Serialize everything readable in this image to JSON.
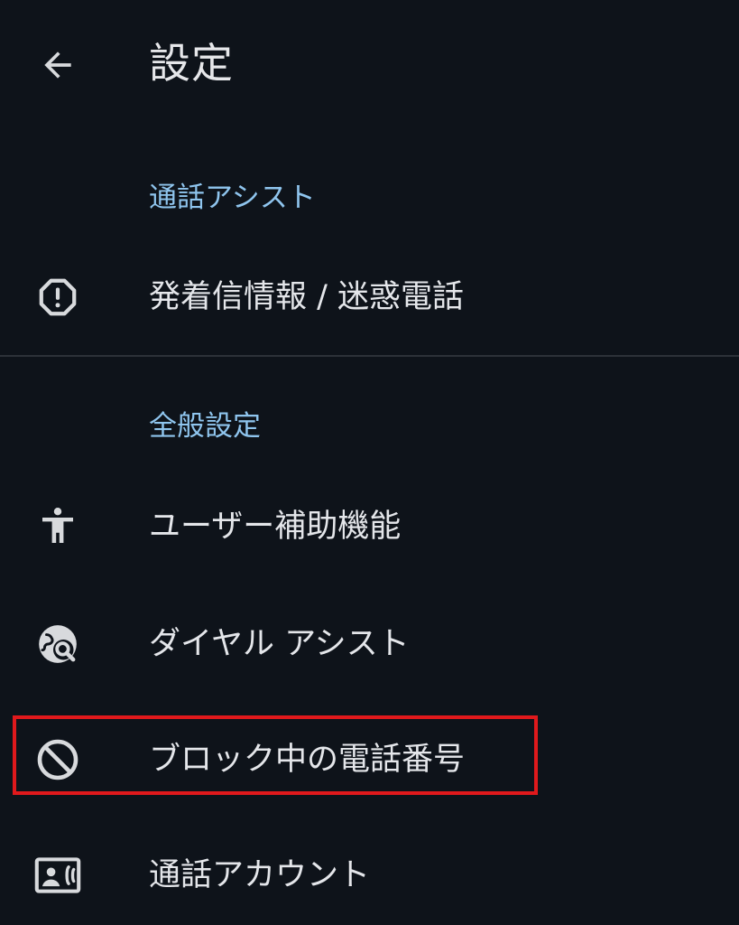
{
  "header": {
    "back_icon": "arrow-left-icon",
    "title": "設定"
  },
  "sections": [
    {
      "header": "通話アシスト",
      "items": [
        {
          "label": "発着信情報 / 迷惑電話",
          "icon": "octagon-alert-icon"
        }
      ]
    },
    {
      "header": "全般設定",
      "items": [
        {
          "label": "ユーザー補助機能",
          "icon": "accessibility-icon"
        },
        {
          "label": "ダイヤル アシスト",
          "icon": "globe-search-icon"
        },
        {
          "label": "ブロック中の電話番号",
          "icon": "block-icon",
          "highlighted": true
        },
        {
          "label": "通話アカウント",
          "icon": "phone-account-icon"
        }
      ]
    }
  ],
  "colors": {
    "background": "#0e131a",
    "text": "#e4e6ea",
    "section_header": "#8fc5ee",
    "highlight_border": "#e0191c",
    "icon": "#d8dadd"
  }
}
